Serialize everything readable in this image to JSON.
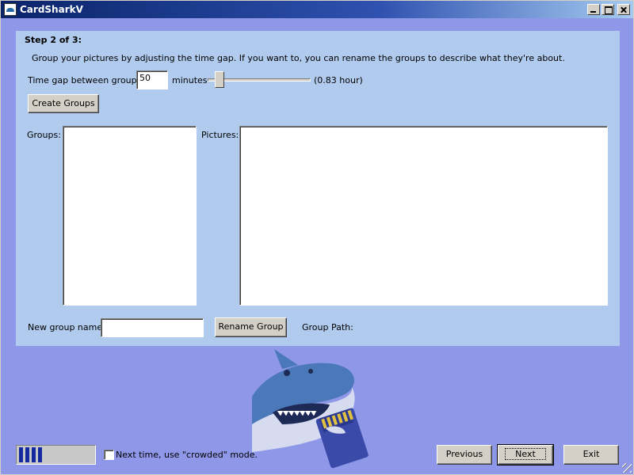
{
  "window": {
    "title": "CardSharkV",
    "app_icon": "shark-icon"
  },
  "panel": {
    "step_title": "Step 2 of 3:",
    "instructions": "Group your pictures by adjusting the time gap. If you want to, you can rename the groups to describe what they're about.",
    "time_gap_label": "Time gap between groups:",
    "time_gap_value": "50",
    "minutes_label": "minutes",
    "slider_level_fraction": 0.06,
    "hours_text": "(0.83 hour)",
    "create_groups_label": "Create Groups",
    "groups_label": "Groups:",
    "groups": [],
    "pictures_label": "Pictures:",
    "pictures": [],
    "new_group_name_label": "New group name:",
    "new_group_name_value": "",
    "rename_group_label": "Rename Group",
    "group_path_label": "Group Path:"
  },
  "footer": {
    "progress_segments_filled": 4,
    "crowded_label": "Next time, use \"crowded\" mode.",
    "crowded_checked": false,
    "previous_label": "Previous",
    "next_label": "Next",
    "exit_label": "Exit"
  },
  "colors": {
    "background": "#8f97e8",
    "panel": "#b0cbee",
    "progress_fill": "#1428a0"
  }
}
